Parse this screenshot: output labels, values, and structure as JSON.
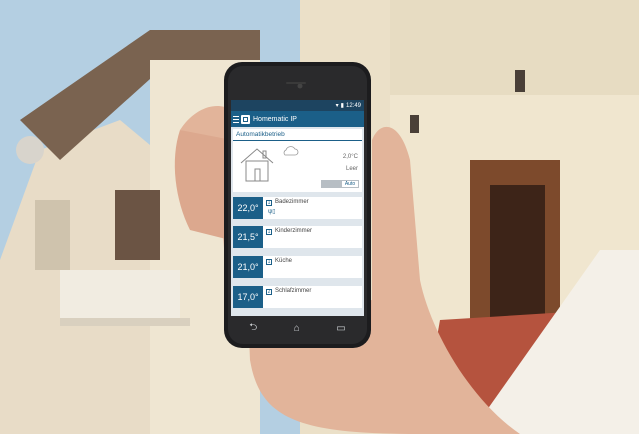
{
  "status_bar": {
    "time": "12:49",
    "signal_icon": "signal-icon",
    "battery_icon": "battery-icon"
  },
  "app": {
    "title": "Homematic IP"
  },
  "auto_panel": {
    "title": "Automatikbetrieb",
    "temperature": "2,0°C",
    "status": "Leer",
    "mode_label": "Auto"
  },
  "rooms": [
    {
      "temp": "22,0°",
      "number": "1",
      "name": "Badezimmer",
      "icons": "ψ▯"
    },
    {
      "temp": "21,5°",
      "number": "1",
      "name": "Kinderzimmer",
      "icons": ""
    },
    {
      "temp": "21,0°",
      "number": "1",
      "name": "Küche",
      "icons": ""
    },
    {
      "temp": "17,0°",
      "number": "2",
      "name": "Schlafzimmer",
      "icons": ""
    }
  ],
  "nav": {
    "back": "back-icon",
    "home": "home-icon",
    "recent": "recent-apps-icon"
  },
  "colors": {
    "brand": "#1b5f88",
    "statusbar": "#1d4460"
  }
}
